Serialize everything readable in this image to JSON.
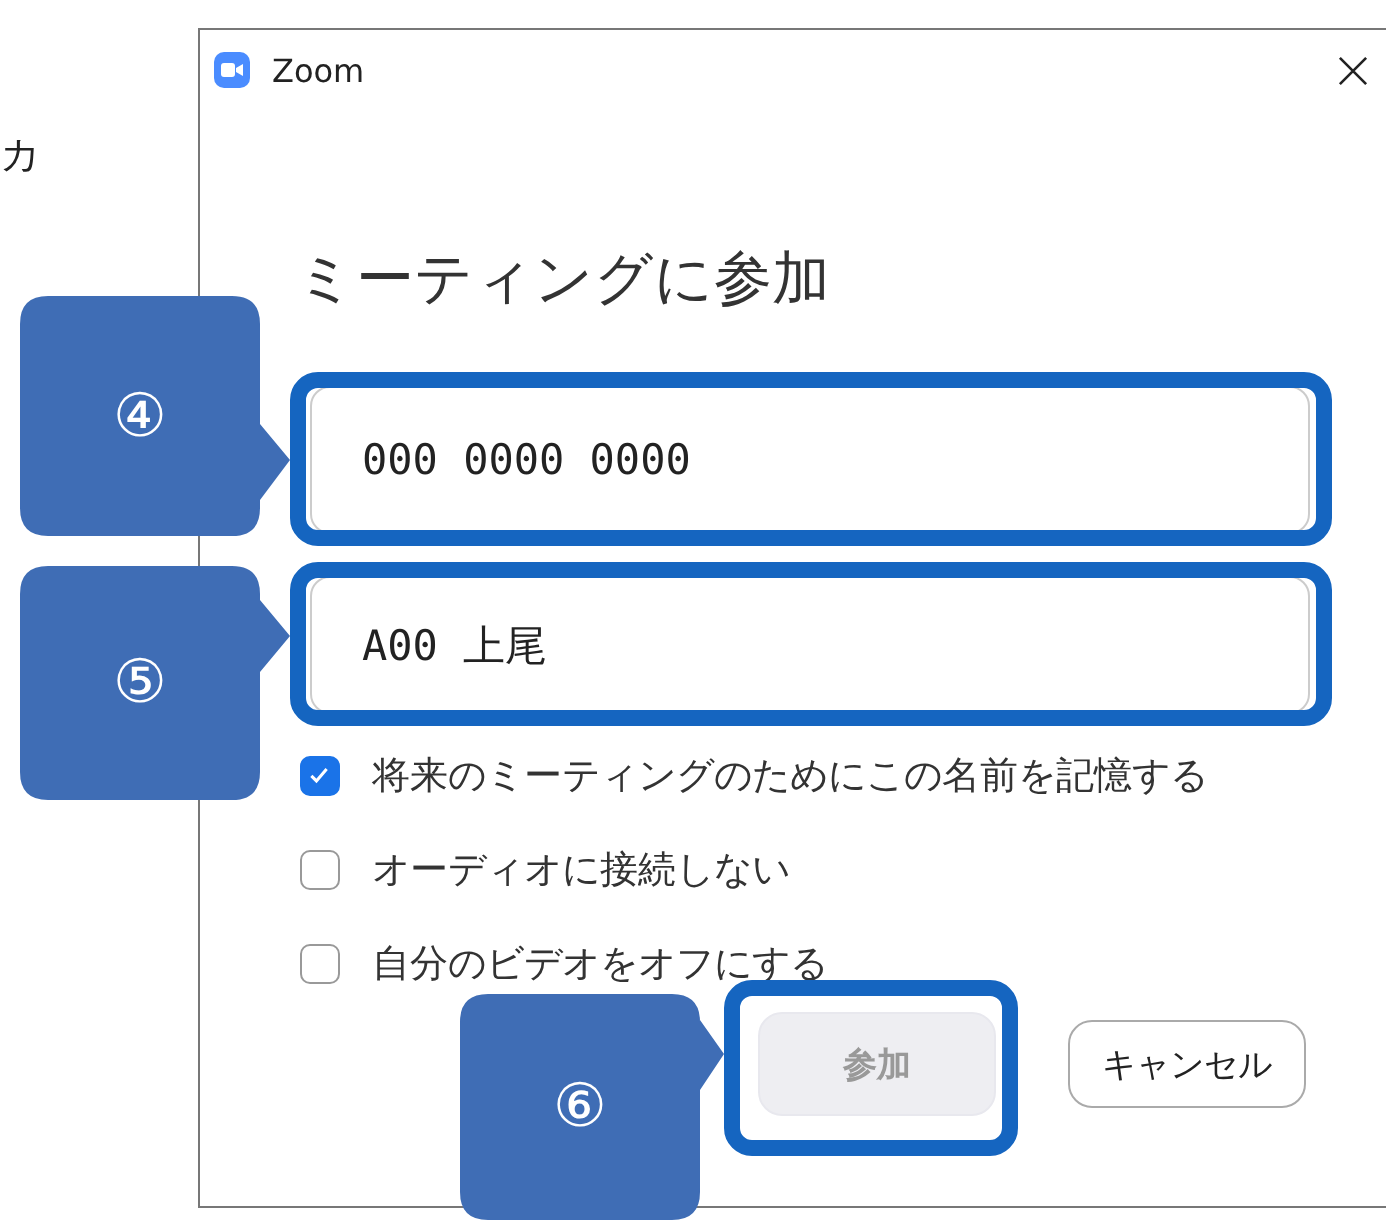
{
  "side_text": "カ",
  "window": {
    "title": "Zoom"
  },
  "heading": "ミーティングに参加",
  "fields": [
    {
      "value": "000 0000 0000"
    },
    {
      "value": "A00 上尾"
    }
  ],
  "checkboxes": [
    {
      "label": "将来のミーティングのためにこの名前を記憶する",
      "checked": true
    },
    {
      "label": "オーディオに接続しない",
      "checked": false
    },
    {
      "label": "自分のビデオをオフにする",
      "checked": false
    }
  ],
  "buttons": [
    {
      "label": "参加",
      "disabled": true
    },
    {
      "label": "キャンセル",
      "disabled": false
    }
  ],
  "callouts": [
    {
      "label": "④"
    },
    {
      "label": "⑤"
    },
    {
      "label": "⑥"
    }
  ]
}
